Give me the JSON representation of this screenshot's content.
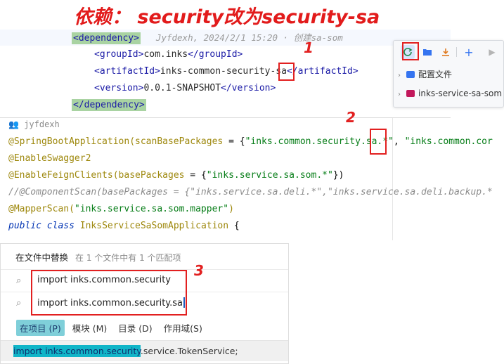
{
  "title": "依赖： security改为security-sa",
  "annotations": {
    "n1": "1",
    "n2": "2",
    "n3": "3"
  },
  "xml_editor": {
    "faded_line": "一ＡＡ    创建sa-som        ",
    "dependency_open": "<dependency>",
    "blame": "Jyfdexh, 2024/2/1 15:20 · 创建sa-som",
    "group_open": "<groupId>",
    "group_value": "com.inks",
    "group_close": "</groupId>",
    "artifact_open": "<artifactId>",
    "artifact_value_pre": "inks-common-security-",
    "artifact_value_hl": "sa",
    "artifact_close": "</artifactId>",
    "version_open": "<version>",
    "version_value": "0.0.1-SNAPSHOT",
    "version_close": "</version>",
    "dependency_close": "</dependency>"
  },
  "maven_panel": {
    "refresh_icon": "refresh-icon",
    "items": [
      {
        "label": "配置文件",
        "icon": "folder-icon",
        "color": "#3574f0"
      },
      {
        "label": "inks-service-sa-som",
        "icon": "maven-module-icon",
        "color": "#c2185b"
      }
    ]
  },
  "java_editor": {
    "author": "jyfdexh",
    "line1_ann": "@SpringBootApplication",
    "line1_paren": "(",
    "line1_param": "scanBasePackages",
    "line1_eq": " = {",
    "line1_str1_pre": "\"inks.common.security",
    "line1_str1_hl": ".sa",
    "line1_str1_post": ".*\"",
    "line1_comma": ", ",
    "line1_str2": "\"inks.common.cor",
    "line2_ann": "@EnableSwagger2",
    "line3_ann": "@EnableFeignClients",
    "line3_paren": "(",
    "line3_param": "basePackages",
    "line3_eq": " = {",
    "line3_str": "\"inks.service.sa.som.*\"",
    "line3_close": "})",
    "line4_comment": "//@ComponentScan(basePackages = {\"inks.service.sa.deli.*\",\"inks.service.sa.deli.backup.*",
    "line5_ann": "@MapperScan",
    "line5_paren": "(",
    "line5_str": "\"inks.service.sa.som.mapper\"",
    "line5_close": ")",
    "line6_kw1": "public",
    "line6_kw2": "class",
    "line6_cls": "InksServiceSaSomApplication",
    "line6_brace": "{"
  },
  "replace_dialog": {
    "title": "在文件中替换",
    "summary": "在 1 个文件中有 1 个匹配项",
    "find_value": "import inks.common.security",
    "replace_value": "import inks.common.security.sa",
    "scopes": [
      {
        "label": "在项目 (P)",
        "active": true
      },
      {
        "label": "模块 (M)",
        "active": false
      },
      {
        "label": "目录 (D)",
        "active": false
      },
      {
        "label": "作用域(S)",
        "active": false
      }
    ],
    "result_hit": "import inks.common.security",
    "result_rest": ".service.TokenService;"
  }
}
